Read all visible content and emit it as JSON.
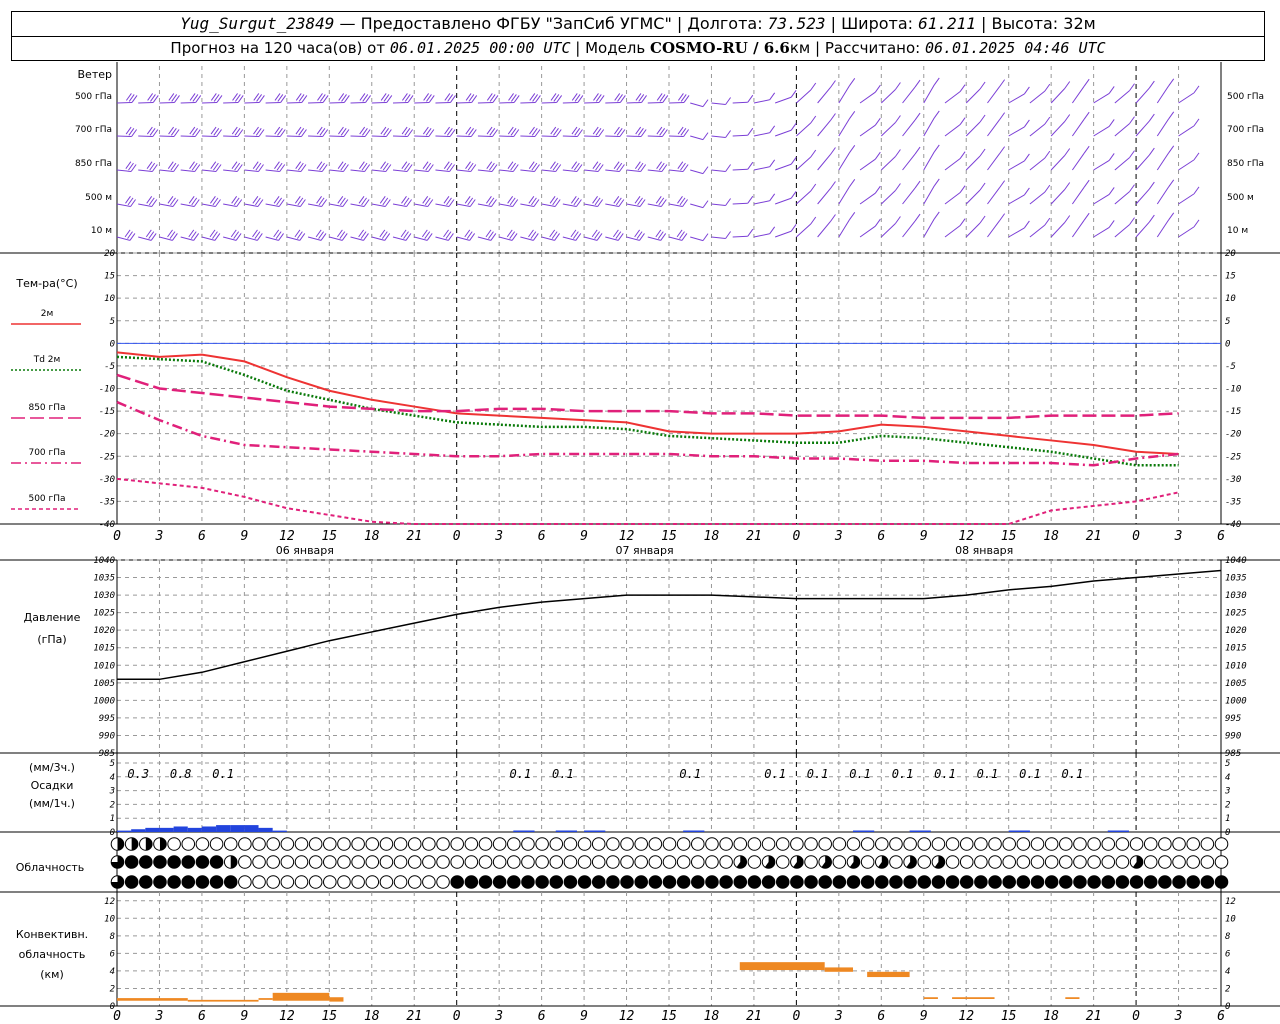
{
  "header": {
    "station": "Yug_Surgut_23849",
    "provider": "— Предоставлено ФГБУ \"ЗапСиб УГМС\"",
    "lon_label": "Долгота:",
    "lon": "73.523",
    "lat_label": "Широта:",
    "lat": "61.211",
    "alt_label": "Высота:",
    "alt": "32м",
    "forecast_prefix": "Прогноз на 120 часа(ов) от",
    "forecast_start": "06.01.2025 00:00 UTC",
    "model_label": "Модель",
    "model": "COSMO-RU / 6.6",
    "model_unit": "км",
    "calc_label": "Рассчитано:",
    "calc_time": "06.01.2025 04:46 UTC"
  },
  "chart_data": [
    {
      "type": "line",
      "id": "wind",
      "title": "Ветер",
      "levels": [
        "500 гПа",
        "700 гПа",
        "850 гПа",
        "500 м",
        "10 м"
      ],
      "color": "#7b3fd6"
    },
    {
      "type": "line",
      "id": "temperature",
      "ylabel": "Тем-ра(°С)",
      "ylim": [
        -40,
        20
      ],
      "yticks": [
        20,
        15,
        10,
        5,
        0,
        -5,
        -10,
        -15,
        -20,
        -25,
        -30,
        -35,
        -40
      ],
      "x_hours": [
        0,
        3,
        6,
        9,
        12,
        15,
        18,
        21,
        24,
        27,
        30,
        33,
        36,
        39,
        42,
        45,
        48,
        51,
        54,
        57,
        60,
        63,
        66,
        69,
        72,
        75
      ],
      "series": [
        {
          "name": "2м",
          "color": "#ee3333",
          "dash": "solid",
          "values": [
            -2,
            -3,
            -2.5,
            -4,
            -7.5,
            -10.5,
            -12.5,
            -14,
            -15.5,
            -16,
            -16.5,
            -17,
            -17.5,
            -19.5,
            -20,
            -20,
            -20,
            -19.5,
            -18,
            -18.5,
            -19.5,
            -20.5,
            -21.5,
            -22.5,
            -24,
            -24.5
          ]
        },
        {
          "name": "Td 2м",
          "color": "#0a7a0a",
          "dash": "dot",
          "values": [
            -3,
            -3.5,
            -4,
            -7,
            -10.5,
            -12.5,
            -14.5,
            -16,
            -17.5,
            -18,
            -18.5,
            -18.5,
            -19,
            -20.5,
            -21,
            -21.5,
            -22,
            -22,
            -20.5,
            -21,
            -22,
            -23,
            -24,
            -25.5,
            -27,
            -27
          ]
        },
        {
          "name": "850 гПа",
          "color": "#e0207a",
          "dash": "long",
          "values": [
            -7,
            -10,
            -11,
            -12,
            -13,
            -14,
            -14.5,
            -15,
            -15,
            -14.5,
            -14.5,
            -15,
            -15,
            -15,
            -15.5,
            -15.5,
            -16,
            -16,
            -16,
            -16.5,
            -16.5,
            -16.5,
            -16,
            -16,
            -16,
            -15.5
          ]
        },
        {
          "name": "700 гПа",
          "color": "#e0207a",
          "dash": "dashdot",
          "values": [
            -13,
            -17,
            -20.5,
            -22.5,
            -23,
            -23.5,
            -24,
            -24.5,
            -25,
            -25,
            -24.5,
            -24.5,
            -24.5,
            -24.5,
            -25,
            -25,
            -25.5,
            -25.5,
            -26,
            -26,
            -26.5,
            -26.5,
            -26.5,
            -27,
            -25.5,
            -24.5
          ]
        },
        {
          "name": "500 гПа",
          "color": "#e0207a",
          "dash": "short",
          "values": [
            -30,
            -31,
            -32,
            -34,
            -36.5,
            -38,
            -39.5,
            -41,
            -42,
            -42,
            -42,
            -42,
            -42,
            -42,
            -42,
            -42,
            -42,
            -42,
            -42,
            -42,
            -42,
            -40,
            -37,
            -36,
            -35,
            -33
          ]
        }
      ],
      "x_step_hours": 3
    },
    {
      "type": "line",
      "id": "pressure",
      "ylabel": "Давление",
      "ylabel2": "(гПа)",
      "ylim": [
        985,
        1040
      ],
      "yticks": [
        1040,
        1035,
        1030,
        1025,
        1020,
        1015,
        1010,
        1005,
        1000,
        995,
        990,
        985
      ],
      "x_step_hours": 3,
      "values": [
        1006,
        1006,
        1008,
        1011,
        1014,
        1017,
        1019.5,
        1022,
        1024.5,
        1026.5,
        1028,
        1029,
        1030,
        1030,
        1030,
        1029.5,
        1029,
        1029,
        1029,
        1029,
        1030,
        1031.5,
        1032.5,
        1034,
        1035,
        1036,
        1037,
        1037
      ]
    },
    {
      "type": "bar",
      "id": "precip",
      "ylabel_top": "(мм/3ч.)",
      "ylabel_mid": "Осадки",
      "ylabel_bot": "(мм/1ч.)",
      "ylim": [
        0,
        5
      ],
      "yticks": [
        5,
        4,
        3,
        2,
        1,
        0
      ],
      "annotations": [
        {
          "h": 1.5,
          "text": "0.3"
        },
        {
          "h": 4.5,
          "text": "0.8"
        },
        {
          "h": 7.5,
          "text": "0.1"
        },
        {
          "h": 28.5,
          "text": "0.1"
        },
        {
          "h": 31.5,
          "text": "0.1"
        },
        {
          "h": 40.5,
          "text": "0.1"
        },
        {
          "h": 46.5,
          "text": "0.1"
        },
        {
          "h": 49.5,
          "text": "0.1"
        },
        {
          "h": 52.5,
          "text": "0.1"
        },
        {
          "h": 55.5,
          "text": "0.1"
        },
        {
          "h": 58.5,
          "text": "0.1"
        },
        {
          "h": 61.5,
          "text": "0.1"
        },
        {
          "h": 64.5,
          "text": "0.1"
        },
        {
          "h": 67.5,
          "text": "0.1"
        }
      ],
      "hourly_values": [
        0.1,
        0.2,
        0.3,
        0.3,
        0.4,
        0.3,
        0.4,
        0.5,
        0.5,
        0.5,
        0.3,
        0.1
      ]
    },
    {
      "type": "table",
      "id": "cloud",
      "ylabel": "Облачность",
      "rows_symbols": [
        "high",
        "mid",
        "low"
      ]
    },
    {
      "type": "bar",
      "id": "convective",
      "ylabel1": "Конвективн.",
      "ylabel2": "облачность",
      "ylabel3": "(км)",
      "ylim": [
        0,
        13
      ],
      "yticks": [
        12,
        10,
        8,
        6,
        4,
        2,
        0
      ],
      "color": "#ee8822",
      "segments": [
        {
          "h0": 0,
          "h1": 5,
          "bottom": 0.6,
          "top": 0.9
        },
        {
          "h0": 5,
          "h1": 10,
          "bottom": 0.5,
          "top": 0.7
        },
        {
          "h0": 10,
          "h1": 11,
          "bottom": 0.7,
          "top": 0.9
        },
        {
          "h0": 11,
          "h1": 15,
          "bottom": 0.6,
          "top": 1.5
        },
        {
          "h0": 15,
          "h1": 16,
          "bottom": 0.5,
          "top": 1.0
        },
        {
          "h0": 44,
          "h1": 50,
          "bottom": 4.1,
          "top": 5.0
        },
        {
          "h0": 50,
          "h1": 52,
          "bottom": 3.9,
          "top": 4.4
        },
        {
          "h0": 53,
          "h1": 56,
          "bottom": 3.3,
          "top": 3.9
        },
        {
          "h0": 57,
          "h1": 58,
          "bottom": 0.8,
          "top": 1.0
        },
        {
          "h0": 59,
          "h1": 62,
          "bottom": 0.8,
          "top": 1.0
        },
        {
          "h0": 67,
          "h1": 68,
          "bottom": 0.8,
          "top": 1.0
        }
      ]
    }
  ],
  "xaxis": {
    "tick_labels": [
      "0",
      "3",
      "6",
      "9",
      "12",
      "15",
      "18",
      "21",
      "0",
      "3",
      "6",
      "9",
      "12",
      "15",
      "18",
      "21",
      "0",
      "3",
      "6",
      "9",
      "12",
      "15",
      "18",
      "21",
      "0",
      "3",
      "6"
    ],
    "day_labels": [
      "06 января",
      "07 января",
      "08 января"
    ]
  }
}
